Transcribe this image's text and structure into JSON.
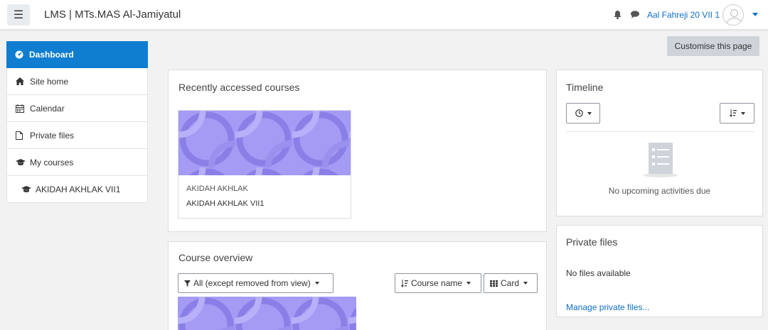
{
  "header": {
    "site_name": "LMS | MTs.MAS Al-Jamiyatul",
    "user_name": "Aal Fahreji 20 VII 1"
  },
  "drawer": {
    "items": [
      {
        "label": "Dashboard",
        "icon": "dashboard-icon",
        "active": true
      },
      {
        "label": "Site home",
        "icon": "home-icon"
      },
      {
        "label": "Calendar",
        "icon": "calendar-icon"
      },
      {
        "label": "Private files",
        "icon": "file-icon"
      },
      {
        "label": "My courses",
        "icon": "graduation-cap-icon"
      },
      {
        "label": "AKIDAH AKHLAK VII1",
        "icon": "graduation-cap-icon"
      }
    ]
  },
  "main": {
    "customise_label": "Customise this page",
    "recent": {
      "title": "Recently accessed courses",
      "course": {
        "category": "AKIDAH AKHLAK",
        "name": "AKIDAH AKHLAK VII1"
      }
    },
    "overview": {
      "title": "Course overview",
      "filter_label": "All (except removed from view)",
      "sort_label": "Course name",
      "view_label": "Card"
    }
  },
  "timeline": {
    "title": "Timeline",
    "empty_message": "No upcoming activities due"
  },
  "private_files": {
    "title": "Private files",
    "empty_message": "No files available",
    "manage_link": "Manage private files..."
  },
  "colors": {
    "accent": "#0f7ed1",
    "link": "#0f6fc5",
    "course_image": "#a49bf5"
  }
}
